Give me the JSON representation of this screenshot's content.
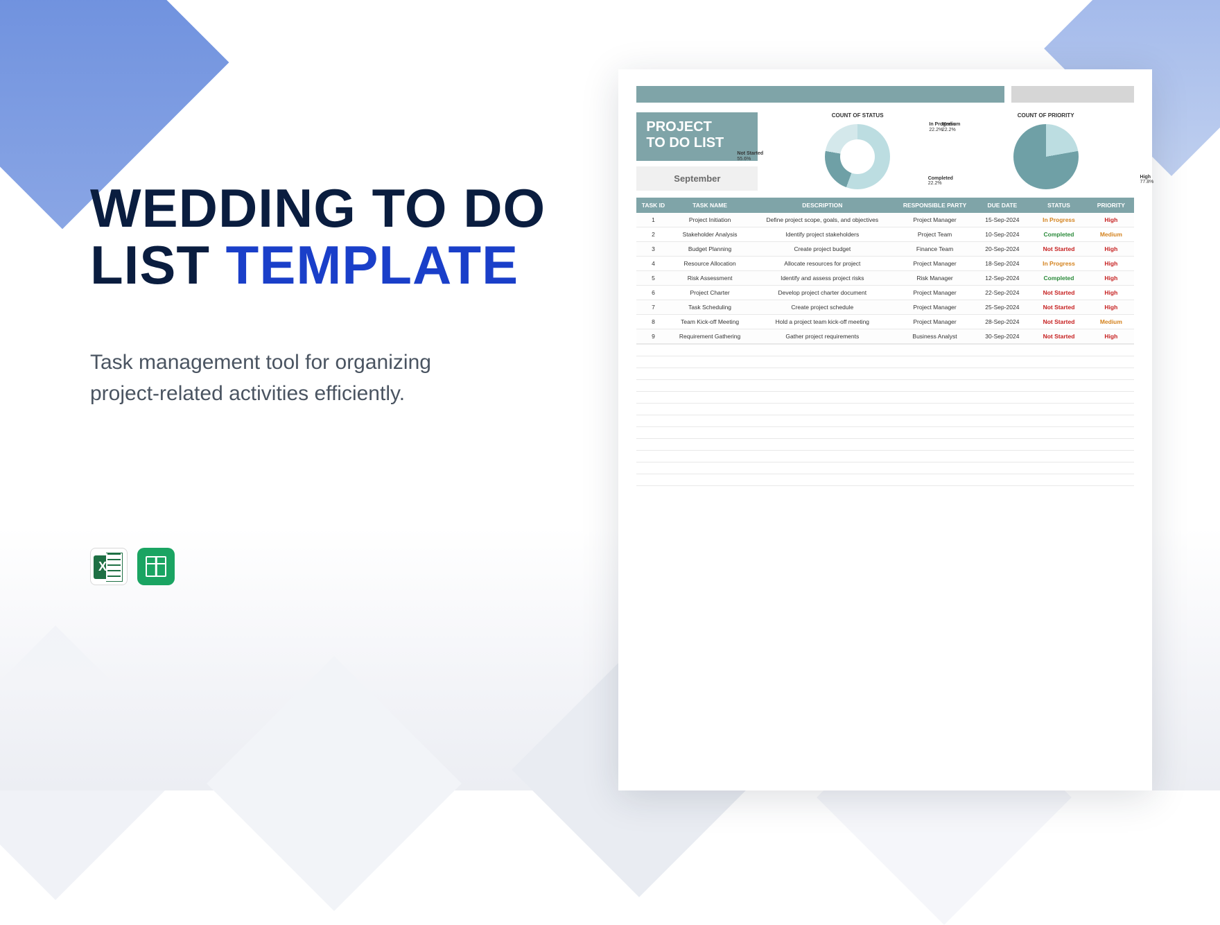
{
  "title_part1": "WEDDING TO DO",
  "title_part2": "LIST ",
  "title_part3": "TEMPLATE",
  "subtitle": "Task management tool for organizing project-related activities efficiently.",
  "sheet": {
    "project_label_line1": "PROJECT",
    "project_label_line2": "TO DO LIST",
    "month": "September",
    "chart1_title": "COUNT OF STATUS",
    "chart2_title": "COUNT OF PRIORITY",
    "chart1_labels": {
      "not_started": "Not Started",
      "not_started_val": "55.6%",
      "in_progress": "In Progress",
      "in_progress_val": "22.2%",
      "completed": "Completed",
      "completed_val": "22.2%"
    },
    "chart2_labels": {
      "medium": "Medium",
      "medium_val": "22.2%",
      "high": "High",
      "high_val": "77.8%"
    },
    "headers": [
      "TASK ID",
      "TASK NAME",
      "DESCRIPTION",
      "RESPONSIBLE PARTY",
      "DUE DATE",
      "STATUS",
      "PRIORITY"
    ],
    "rows": [
      {
        "id": "1",
        "name": "Project Initiation",
        "desc": "Define project scope, goals, and objectives",
        "party": "Project Manager",
        "due": "15-Sep-2024",
        "status": "In Progress",
        "status_cls": "st-progress",
        "priority": "High",
        "pr_cls": "pr-high"
      },
      {
        "id": "2",
        "name": "Stakeholder Analysis",
        "desc": "Identify project stakeholders",
        "party": "Project Team",
        "due": "10-Sep-2024",
        "status": "Completed",
        "status_cls": "st-completed",
        "priority": "Medium",
        "pr_cls": "pr-medium"
      },
      {
        "id": "3",
        "name": "Budget Planning",
        "desc": "Create project budget",
        "party": "Finance Team",
        "due": "20-Sep-2024",
        "status": "Not Started",
        "status_cls": "st-notstarted",
        "priority": "High",
        "pr_cls": "pr-high"
      },
      {
        "id": "4",
        "name": "Resource Allocation",
        "desc": "Allocate resources for project",
        "party": "Project Manager",
        "due": "18-Sep-2024",
        "status": "In Progress",
        "status_cls": "st-progress",
        "priority": "High",
        "pr_cls": "pr-high"
      },
      {
        "id": "5",
        "name": "Risk Assessment",
        "desc": "Identify and assess project risks",
        "party": "Risk Manager",
        "due": "12-Sep-2024",
        "status": "Completed",
        "status_cls": "st-completed",
        "priority": "High",
        "pr_cls": "pr-high"
      },
      {
        "id": "6",
        "name": "Project Charter",
        "desc": "Develop project charter document",
        "party": "Project Manager",
        "due": "22-Sep-2024",
        "status": "Not Started",
        "status_cls": "st-notstarted",
        "priority": "High",
        "pr_cls": "pr-high"
      },
      {
        "id": "7",
        "name": "Task Scheduling",
        "desc": "Create project schedule",
        "party": "Project Manager",
        "due": "25-Sep-2024",
        "status": "Not Started",
        "status_cls": "st-notstarted",
        "priority": "High",
        "pr_cls": "pr-high"
      },
      {
        "id": "8",
        "name": "Team Kick-off Meeting",
        "desc": "Hold a project team kick-off meeting",
        "party": "Project Manager",
        "due": "28-Sep-2024",
        "status": "Not Started",
        "status_cls": "st-notstarted",
        "priority": "Medium",
        "pr_cls": "pr-medium"
      },
      {
        "id": "9",
        "name": "Requirement Gathering",
        "desc": "Gather project requirements",
        "party": "Business Analyst",
        "due": "30-Sep-2024",
        "status": "Not Started",
        "status_cls": "st-notstarted",
        "priority": "High",
        "pr_cls": "pr-high"
      }
    ]
  },
  "chart_data": [
    {
      "type": "pie",
      "title": "COUNT OF STATUS",
      "series": [
        {
          "name": "Status",
          "categories": [
            "Not Started",
            "In Progress",
            "Completed"
          ],
          "values": [
            55.6,
            22.2,
            22.2
          ]
        }
      ]
    },
    {
      "type": "pie",
      "title": "COUNT OF PRIORITY",
      "series": [
        {
          "name": "Priority",
          "categories": [
            "Medium",
            "High"
          ],
          "values": [
            22.2,
            77.8
          ]
        }
      ]
    }
  ]
}
